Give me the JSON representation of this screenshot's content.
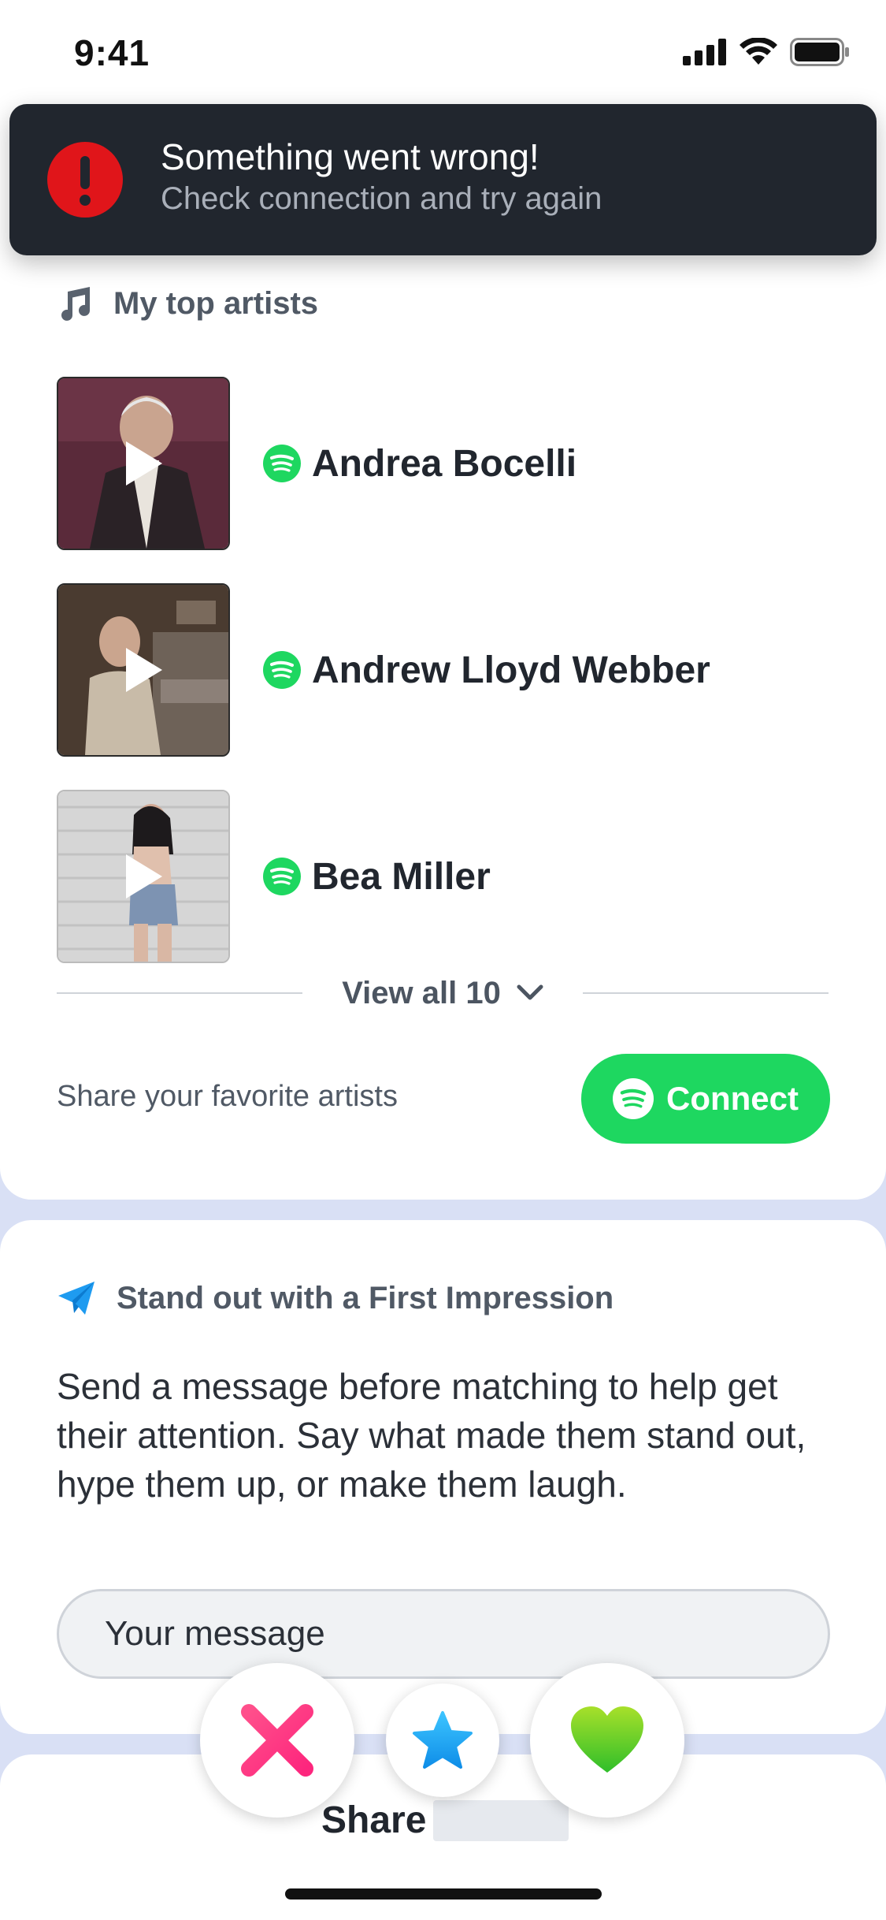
{
  "status_bar": {
    "time": "9:41"
  },
  "toast": {
    "title": "Something went wrong!",
    "subtitle": "Check connection and try again",
    "icon": "alert-icon",
    "color": "#e0151a"
  },
  "top_artists": {
    "title": "My top artists",
    "icon": "music-note-icon",
    "artists": [
      {
        "name": "Andrea Bocelli"
      },
      {
        "name": "Andrew Lloyd Webber"
      },
      {
        "name": "Bea Miller"
      }
    ],
    "view_all_label": "View all 10",
    "share_text": "Share your favorite artists",
    "connect_label": "Connect",
    "spotify_color": "#1ed760"
  },
  "first_impression": {
    "title": "Stand out with a First Impression",
    "icon": "paper-plane-icon",
    "body": "Send a message before matching to help get their attention. Say what made them stand out, hype them up, or make them laugh.",
    "placeholder": "Your message"
  },
  "share_card": {
    "label": "Share"
  },
  "actions": {
    "nope_icon": "x-icon",
    "super_like_icon": "star-icon",
    "like_icon": "heart-icon"
  }
}
